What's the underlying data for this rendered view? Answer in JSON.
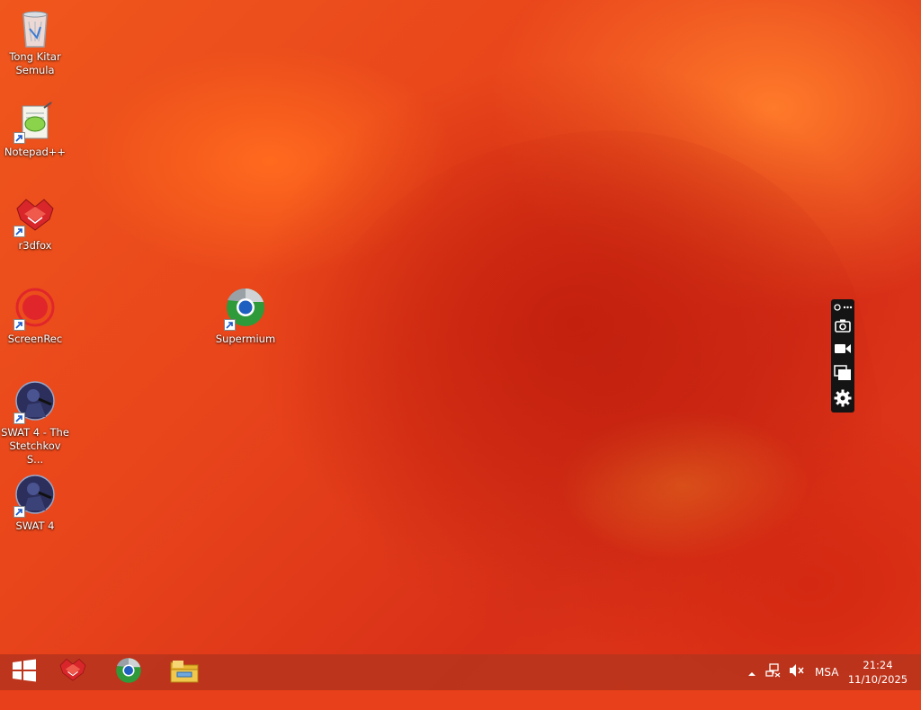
{
  "desktop": {
    "icons": [
      {
        "label": "Tong Kitar\nSemula",
        "icon": "recycle-bin-icon"
      },
      {
        "label": "Notepad++",
        "icon": "notepad-plus-plus-icon"
      },
      {
        "label": "r3dfox",
        "icon": "r3dfox-icon"
      },
      {
        "label": "ScreenRec",
        "icon": "screenrec-icon"
      },
      {
        "label": "SWAT 4 - The\nStetchkov S...",
        "icon": "swat4-stetchkov-icon"
      },
      {
        "label": "SWAT 4",
        "icon": "swat4-icon"
      },
      {
        "label": "Supermium",
        "icon": "supermium-icon"
      }
    ]
  },
  "capture_toolbar": {
    "items": [
      "pin-more-icon",
      "camera-icon",
      "video-icon",
      "copy-icon",
      "settings-gear-icon"
    ]
  },
  "taskbar": {
    "pinned": [
      "start-windows-icon",
      "r3dfox-icon",
      "supermium-icon",
      "file-explorer-icon"
    ],
    "tray": {
      "chevron": "show-hidden-icons-icon",
      "network": "network-icon",
      "volume": "volume-muted-icon",
      "language": "MSA",
      "time": "21:24",
      "date": "11/10/2025"
    }
  },
  "colors": {
    "wallpaper": "#e8401a",
    "taskbar": "#ba341c",
    "capture_bar": "#141414"
  }
}
